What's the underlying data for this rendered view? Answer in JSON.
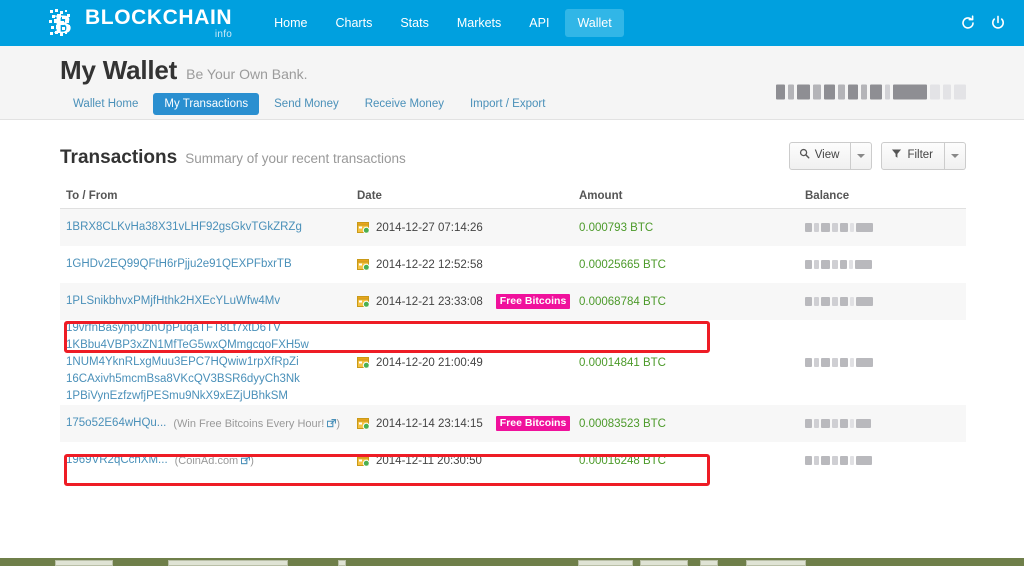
{
  "topnav": {
    "brand_name": "BLOCKCHAIN",
    "brand_sub": "info",
    "brand_color": "#00a0df",
    "active_color": "#31b6e7",
    "items": [
      {
        "label": "Home",
        "active": false
      },
      {
        "label": "Charts",
        "active": false
      },
      {
        "label": "Stats",
        "active": false
      },
      {
        "label": "Markets",
        "active": false
      },
      {
        "label": "API",
        "active": false
      },
      {
        "label": "Wallet",
        "active": true
      }
    ],
    "refresh_icon": "refresh-icon",
    "power_icon": "power-icon"
  },
  "wallet": {
    "title": "My Wallet",
    "tagline": "Be Your Own Bank.",
    "balance_redacted": "█.████████ BTC",
    "subnav": [
      {
        "label": "Wallet Home",
        "active": false
      },
      {
        "label": "My Transactions",
        "active": true
      },
      {
        "label": "Send Money",
        "active": false
      },
      {
        "label": "Receive Money",
        "active": false
      },
      {
        "label": "Import / Export",
        "active": false
      }
    ],
    "subnav_active_color": "#2a8fd0"
  },
  "transactions": {
    "heading": "Transactions",
    "summary": "Summary of your recent transactions",
    "view_button": "View",
    "filter_button": "Filter",
    "view_icon": "search-icon",
    "filter_icon": "funnel-icon",
    "columns": [
      "To / From",
      "Date",
      "Amount",
      "Balance"
    ],
    "badge_color": "#f0119c",
    "amount_color": "#4c9a2a",
    "link_color": "#4a90b9",
    "highlight_color": "#ee1c25",
    "rows": [
      {
        "addresses": [
          "1BRX8CLKvHa38X31vLHF92gsGkvTGkZRZg"
        ],
        "note": "",
        "date": "2014-12-27 07:14:26",
        "badge": "",
        "amount": "0.000793 BTC",
        "balance_redacted": "█.██████ BTC",
        "highlighted": false
      },
      {
        "addresses": [
          "1GHDv2EQ99QFtH6rPjju2e91QEXPFbxrTB"
        ],
        "note": "",
        "date": "2014-12-22 12:52:58",
        "badge": "",
        "amount": "0.00025665 BTC",
        "balance_redacted": "█.██████ BTC",
        "highlighted": false
      },
      {
        "addresses": [
          "1PLSnikbhvxPMjfHthk2HXEcYLuWfw4Mv"
        ],
        "note": "",
        "date": "2014-12-21 23:33:08",
        "badge": "Free Bitcoins",
        "amount": "0.00068784 BTC",
        "balance_redacted": "█.██████ BTC",
        "highlighted": true
      },
      {
        "addresses": [
          "19vrfnBasyhpUbnUpPuqaTFT8Lt7xtD6TV",
          "1KBbu4VBP3xZN1MfTeG5wxQMmgcqoFXH5w",
          "1NUM4YknRLxgMuu3EPC7HQwiw1rpXfRpZi",
          "16CAxivh5mcmBsa8VKcQV3BSR6dyyCh3Nk",
          "1PBiVynEzfzwfjPESmu9NkX9xEZjUBhkSM"
        ],
        "note": "",
        "date": "2014-12-20 21:00:49",
        "badge": "",
        "amount": "0.00014841 BTC",
        "balance_redacted": "█.██████ BTC",
        "highlighted": false
      },
      {
        "addresses": [
          "175o52E64wHQu..."
        ],
        "note": "(Win Free Bitcoins Every Hour!",
        "note_link_icon": "external-link-icon",
        "note_tail": ")",
        "date": "2014-12-14 23:14:15",
        "badge": "Free Bitcoins",
        "amount": "0.00083523 BTC",
        "balance_redacted": "█.██████ BTC",
        "highlighted": true
      },
      {
        "addresses": [
          "1969VR2qCchXM..."
        ],
        "note": "(CoinAd.com",
        "note_link_icon": "external-link-icon",
        "note_tail": ")",
        "date": "2014-12-11 20:30:50",
        "badge": "",
        "amount": "0.00016248 BTC",
        "balance_redacted": "█.██████ BTC",
        "highlighted": false
      }
    ]
  }
}
